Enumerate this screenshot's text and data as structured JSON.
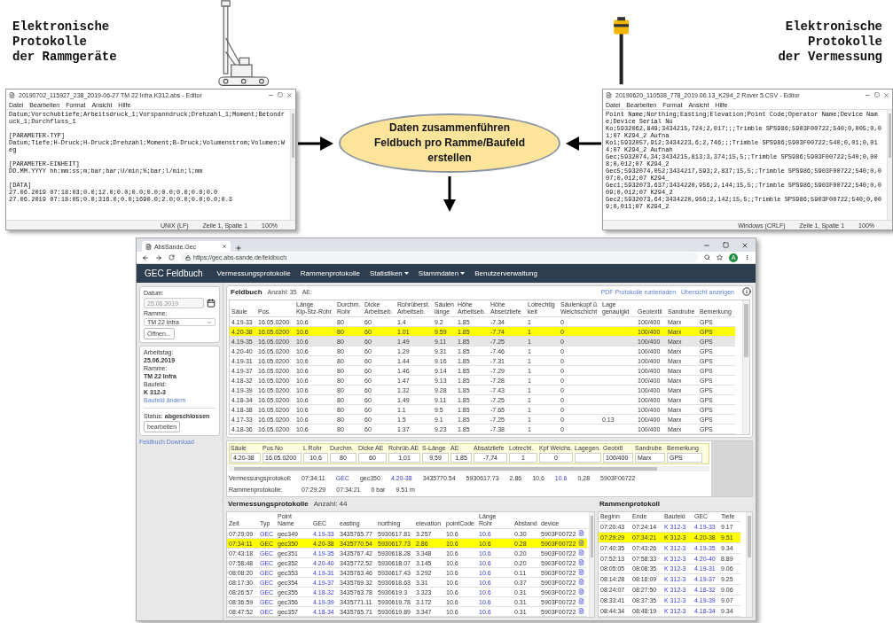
{
  "diagram": {
    "left_caption": [
      "Elektronische",
      "Protokolle",
      "der Rammgeräte"
    ],
    "right_caption": [
      "Elektronische",
      "Protokolle",
      "der Vermessung"
    ],
    "process": [
      "Daten zusammenführen",
      "Feldbuch pro Ramme/Baufeld",
      "erstellen"
    ],
    "left_editor": {
      "title": "20190702_115927_238_2019-06-27 TM 22 Infra K312.abs - Editor",
      "menu": [
        "Datei",
        "Bearbeiten",
        "Format",
        "Ansicht",
        "Hilfe"
      ],
      "blocks": [
        [
          "Datum;Vorschubtiefe;Arbeitsdruck_1;Vorspanndruck;Drehzahl_1;Moment;Betondruck_1;Durchfluss_1"
        ],
        [
          "[PARAMETER-TYP]",
          "Datum;Tiefe;H-Druck;H-Druck;Drehzahl;Moment;B-Druck;Volumenstrom;Volumen;Weg"
        ],
        [
          "[PARAMETER-EINHEIT]",
          "DD.MM.YYYY hh:mm:ss;m;bar;bar;U/min;%;bar;l/min;l;mm"
        ],
        [
          "[DATA]",
          "27.06.2019 07:18:03;0.0;12.0;0.0;0.0;0.0;0.0;0.0;0.0;0.0",
          "27.06.2019 07:18:05;0.0;316.0;0.0;1690.0;2.0;0.0;0.0;0.0;0.3"
        ]
      ],
      "status": [
        "UNIX (LF)",
        "Zeile 1, Spalte 1",
        "100%"
      ]
    },
    "right_editor": {
      "title": "20190620_110538_778_2019.06.13_K294_2 Rover 5.CSV - Editor",
      "menu": [
        "Datei",
        "Bearbeiten",
        "Format",
        "Ansicht",
        "Hilfe"
      ],
      "blocks": [
        [
          "Point Name;Northing;Easting;Elevation;Point Code;Operator Name;Device Name;Device Serial Nu",
          "Ko;5932062,849;3434215,724;2,017;;;Trimble SPS986;5903F00722;540;0,005;0,01;07 K294_2 Aufna",
          "Ko1;5932057,912;3434223,6;2,746;;;Trimble SPS986;5903F00722;540;0,01;0,014;07 K294_2 Aufnah",
          "Gec;5932074,34;3434215,813;3,374;15,5;;Trimble SPS986;5903F00722;540;0,008;0,012;07 K294_2",
          "Gec5;5932074,052;3434217,593;2,837;15,5;;Trimble SPS986;5903F00722;540;0,007;0,012;07 K294_",
          "Gec1;5932073,637;3434220,956;2,144;15,5;;Trimble SPS986;5903F00722;540;0,009;0,012;07 K294_2",
          "Gec2;5932073,64;3434220,956;2,142;15,5;;Trimble SPS986;5903F00722;540;0,009;0,011;07 K294_2"
        ]
      ],
      "status": [
        "Windows (CRLF)",
        "Zeile 1, Spalte 1",
        "100%"
      ]
    }
  },
  "browser": {
    "tab": {
      "title": "AbsSande.Gec"
    },
    "url": "https://gec.abs-sande.de/feldbuch",
    "avatar": "A",
    "nav": {
      "brand": "GEC Feldbuch",
      "items": [
        {
          "label": "Vermessungsprotokolle",
          "dropdown": false
        },
        {
          "label": "Rammenprotokolle",
          "dropdown": false
        },
        {
          "label": "Statistiken",
          "dropdown": true
        },
        {
          "label": "Stammdaten",
          "dropdown": true
        },
        {
          "label": "Benutzerverwaltung",
          "dropdown": false
        }
      ]
    },
    "sidebar": {
      "date_label": "Datum:",
      "date": "25.06.2019",
      "date_disabled": true,
      "ramme_label": "Ramme:",
      "ramme": "TM 22 Infra",
      "open_button": "Öffnen...",
      "info": [
        {
          "label": "Arbeitstag:",
          "value": "25.06.2019"
        },
        {
          "label": "Ramme:",
          "value": "TM 22 Infra"
        },
        {
          "label": "Baufeld:",
          "value": "K 312-3"
        }
      ],
      "change_link": "Baufeld ändern",
      "status": "Status: **abgeschlossen**",
      "edit_button": "bearbeiten",
      "download_link": "Feldbuch Download"
    },
    "feldbuch": {
      "title": "Feldbuch",
      "count": "Anzahl: 35",
      "ae": "AE:",
      "links": [
        "PDF Protokolle runterladen",
        "Übersicht anzeigen"
      ],
      "columns": [
        "Säule",
        "Pos.",
        "Länge\nKlp-Stz-Rohr",
        "Durchm.\nRohr",
        "Dicke\nArbeitseb.",
        "Rohrüberst.\nArbeitseb.",
        "Säulen\nlänge",
        "Höhe\nArbeitseb.",
        "Höhe\nAbsetztiefe",
        "Lotrechtig\nkeit",
        "Säulenkopf ü.\nWeichschicht",
        "Lage\ngenauigkt",
        "Geotextil",
        "Sandrube",
        "Bemerkung"
      ],
      "rows": [
        {
          "cells": [
            "4.19-33",
            "16.05.0200",
            "10.6",
            "80",
            "60",
            "1.4",
            "9.2",
            "1.85",
            "-7.34",
            "1",
            "0",
            null,
            "100/400",
            "Marx",
            "GPS"
          ],
          "selected": false,
          "hovered": false
        },
        {
          "cells": [
            "4.20-38",
            "16.05.0200",
            "10.6",
            "80",
            "60",
            "1.01",
            "9.59",
            "1.85",
            "-7.74",
            "1",
            "0",
            null,
            "100/400",
            "Marx",
            "GPS"
          ],
          "selected": true,
          "hovered": false
        },
        {
          "cells": [
            "4.19-35",
            "16.05.0200",
            "10.6",
            "80",
            "60",
            "1.49",
            "9.11",
            "1.85",
            "-7.25",
            "1",
            "0",
            null,
            "100/400",
            "Marx",
            "GPS"
          ],
          "selected": false,
          "hovered": true
        },
        {
          "cells": [
            "4.20-40",
            "16.05.0200",
            "10.6",
            "80",
            "60",
            "1.29",
            "9.31",
            "1.85",
            "-7.46",
            "1",
            "0",
            null,
            "100/400",
            "Marx",
            "GPS"
          ],
          "selected": false,
          "hovered": false
        },
        {
          "cells": [
            "4.19-31",
            "16.05.0200",
            "10.6",
            "80",
            "60",
            "1.44",
            "9.16",
            "1.85",
            "-7.31",
            "1",
            "0",
            null,
            "100/400",
            "Marx",
            "GPS"
          ],
          "selected": false,
          "hovered": false
        },
        {
          "cells": [
            "4.19-37",
            "16.05.0200",
            "10.6",
            "80",
            "60",
            "1.46",
            "9.14",
            "1.85",
            "-7.29",
            "1",
            "0",
            null,
            "100/400",
            "Marx",
            "GPS"
          ],
          "selected": false,
          "hovered": false
        },
        {
          "cells": [
            "4.18-32",
            "16.05.0200",
            "10.6",
            "80",
            "60",
            "1.47",
            "9.13",
            "1.85",
            "-7.28",
            "1",
            "0",
            null,
            "100/400",
            "Marx",
            "GPS"
          ],
          "selected": false,
          "hovered": false
        },
        {
          "cells": [
            "4.19-39",
            "16.05.0200",
            "10.6",
            "80",
            "60",
            "1.32",
            "9.28",
            "1.85",
            "-7.43",
            "1",
            "0",
            null,
            "100/400",
            "Marx",
            "GPS"
          ],
          "selected": false,
          "hovered": false
        },
        {
          "cells": [
            "4.18-34",
            "16.05.0200",
            "10.6",
            "80",
            "60",
            "1.49",
            "9.11",
            "1.85",
            "-7.25",
            "1",
            "0",
            null,
            "100/400",
            "Marx",
            "GPS"
          ],
          "selected": false,
          "hovered": false
        },
        {
          "cells": [
            "4.18-38",
            "16.05.0200",
            "10.6",
            "80",
            "60",
            "1.1",
            "9.5",
            "1.85",
            "-7.65",
            "1",
            "0",
            null,
            "100/400",
            "Marx",
            "GPS"
          ],
          "selected": false,
          "hovered": false
        },
        {
          "cells": [
            "4.17-33",
            "16.05.0200",
            "10.6",
            "80",
            "60",
            "1.5",
            "9.1",
            "1.85",
            "-7.25",
            "1",
            "0",
            "0.13",
            "100/400",
            "Marx",
            "GPS"
          ],
          "selected": false,
          "hovered": false
        },
        {
          "cells": [
            "4.18-36",
            "16.05.0200",
            "10.6",
            "80",
            "60",
            "1.37",
            "9.23",
            "1.85",
            "-7.38",
            "1",
            "0",
            null,
            "100/400",
            "Marx",
            "GPS"
          ],
          "selected": false,
          "hovered": false
        }
      ]
    },
    "detail": {
      "fields": [
        {
          "label": "Säule",
          "value": "4.20-38"
        },
        {
          "label": "Pos.No",
          "value": "16.05.0200"
        },
        {
          "label": "L Rohr",
          "value": "10,6"
        },
        {
          "label": "Durchm.",
          "value": "80"
        },
        {
          "label": "Dicke AE",
          "value": "60"
        },
        {
          "label": "Rohrüb.AE",
          "value": "1,01"
        },
        {
          "label": "S-Länge",
          "value": "9,59"
        },
        {
          "label": "AE",
          "value": "1,85"
        },
        {
          "label": "Absatztiefe",
          "value": "-7,74"
        },
        {
          "label": "Lotrecht.",
          "value": "1"
        },
        {
          "label": "Kpf Weichs.",
          "value": "0"
        },
        {
          "label": "Lagegen."
        },
        {
          "label": "Geotxtl",
          "value": "100/400"
        },
        {
          "label": "Sandrube",
          "value": "Marx"
        },
        {
          "label": "Bemerkung",
          "value": "GPS"
        }
      ],
      "survey": {
        "label": "Vermessungsprotokoll:",
        "values": [
          {
            "text": "07:34:11",
            "link": false
          },
          {
            "text": "GEC",
            "link": true
          },
          {
            "text": "gec350",
            "link": false
          },
          {
            "text": "4.20-38",
            "link": true
          },
          {
            "text": "3435770.54",
            "link": false
          },
          {
            "text": "5930617.73",
            "link": false
          },
          {
            "text": "2.86",
            "link": false
          },
          {
            "text": "10,6",
            "link": false
          },
          {
            "text": "10.6",
            "link": true
          },
          {
            "text": "0,28",
            "link": false
          },
          {
            "text": "5903F00722",
            "link": false
          }
        ]
      },
      "ramming": {
        "label": "Rammenprotokolle:",
        "values": [
          {
            "text": "07:29:29",
            "link": false
          },
          {
            "text": "07:34:21",
            "link": false
          },
          {
            "text": "0 bar",
            "link": false
          },
          {
            "text": "9.51 m",
            "link": false
          }
        ]
      }
    },
    "vermessung": {
      "title": "Vermessungsprotokolle",
      "count": "Anzahl: 44",
      "columns": [
        {
          "label": "Zeit",
          "link": false
        },
        {
          "label": "Typ",
          "link": true
        },
        {
          "label": "Point Name",
          "link": false
        },
        {
          "label": "GEC",
          "link": true
        },
        {
          "label": "easting",
          "link": false
        },
        {
          "label": "northing",
          "link": false
        },
        {
          "label": "elevation",
          "link": false
        },
        {
          "label": "pointCode",
          "link": false
        },
        {
          "label": "Länge Rohr",
          "link": true
        },
        {
          "label": "Abstand",
          "link": false
        },
        {
          "label": "device",
          "link": false
        }
      ],
      "rows": [
        {
          "cells": [
            "07:29:09",
            "GEC",
            "gec349",
            "4.19-33",
            "3435765.77",
            "5930617.81",
            "3.257",
            "10.6",
            "10.6",
            "0.30",
            "5903F00722"
          ],
          "selected": false
        },
        {
          "cells": [
            "07:34:11",
            "GEC",
            "gec350",
            "4.20-38",
            "3435770.54",
            "5930617.73",
            "2.86",
            "10.6",
            "10.6",
            "0.28",
            "5903F00722"
          ],
          "selected": true
        },
        {
          "cells": [
            "07:43:18",
            "GEC",
            "gec351",
            "4.19-35",
            "3435767.42",
            "5930618.28",
            "3.348",
            "10.6",
            "10.6",
            "0.20",
            "5903F00722"
          ],
          "selected": false
        },
        {
          "cells": [
            "07:58:48",
            "GEC",
            "gec352",
            "4.20-40",
            "3435772.52",
            "5930618.07",
            "3.145",
            "10.6",
            "10.6",
            "0.20",
            "5903F00722"
          ],
          "selected": false
        },
        {
          "cells": [
            "08:08:20",
            "GEC",
            "gec353",
            "4.19-31",
            "3435763.46",
            "5930617.43",
            "3.292",
            "10.6",
            "10.6",
            "0.11",
            "5903F00722"
          ],
          "selected": false
        },
        {
          "cells": [
            "08:17:30",
            "GEC",
            "gec354",
            "4.19-37",
            "3435769.32",
            "5930618.63",
            "3.31",
            "10.6",
            "10.6",
            "0.37",
            "5903F00722"
          ],
          "selected": false
        },
        {
          "cells": [
            "08:26:57",
            "GEC",
            "gec355",
            "4.18-32",
            "3435763.78",
            "5930619.3",
            "3.323",
            "10.6",
            "10.6",
            "0.31",
            "5903F00722"
          ],
          "selected": false
        },
        {
          "cells": [
            "08:36:59",
            "GEC",
            "gec356",
            "4.19-39",
            "3435771.11",
            "5930619.78",
            "3.172",
            "10.6",
            "10.6",
            "0.31",
            "5903F00722"
          ],
          "selected": false
        },
        {
          "cells": [
            "08:47:52",
            "GEC",
            "gec357",
            "4.18-34",
            "3435765.71",
            "5930619.89",
            "3.347",
            "10.6",
            "10.6",
            "0.31",
            "5903F00722"
          ],
          "selected": false
        }
      ]
    },
    "rammen": {
      "title": "Rammenprotokoll",
      "columns": [
        {
          "label": "Beginn",
          "link": false
        },
        {
          "label": "Ende",
          "link": false
        },
        {
          "label": "Baufeld",
          "link": true
        },
        {
          "label": "GEC",
          "link": true
        },
        {
          "label": "Tiefe",
          "link": false
        }
      ],
      "rows": [
        {
          "cells": [
            "07:20:43",
            "07:24:14",
            "K 312-3",
            "4.19-33",
            "9.17"
          ],
          "selected": false
        },
        {
          "cells": [
            "07:29:29",
            "07:34:21",
            "K 312-3",
            "4.20-38",
            "9.51"
          ],
          "selected": true
        },
        {
          "cells": [
            "07:40:35",
            "07:43:26",
            "K 312-3",
            "4.19-35",
            "9.34"
          ],
          "selected": false
        },
        {
          "cells": [
            "07:52:13",
            "07:58:33",
            "K 312-3",
            "4.20-40",
            "8.89"
          ],
          "selected": false
        },
        {
          "cells": [
            "08:05:05",
            "08:08:35",
            "K 312-3",
            "4.19-31",
            "9.06"
          ],
          "selected": false
        },
        {
          "cells": [
            "08:14:28",
            "08:18:09",
            "K 312-3",
            "4.19-37",
            "9.25"
          ],
          "selected": false
        },
        {
          "cells": [
            "08:24:07",
            "08:27:50",
            "K 312-3",
            "4.18-32",
            "9.06"
          ],
          "selected": false
        },
        {
          "cells": [
            "08:33:41",
            "08:37:35",
            "K 312-3",
            "4.19-39",
            "9.07"
          ],
          "selected": false
        },
        {
          "cells": [
            "08:44:34",
            "08:48:19",
            "K 312-3",
            "4.18-34",
            "9.34"
          ],
          "selected": false
        }
      ]
    }
  }
}
